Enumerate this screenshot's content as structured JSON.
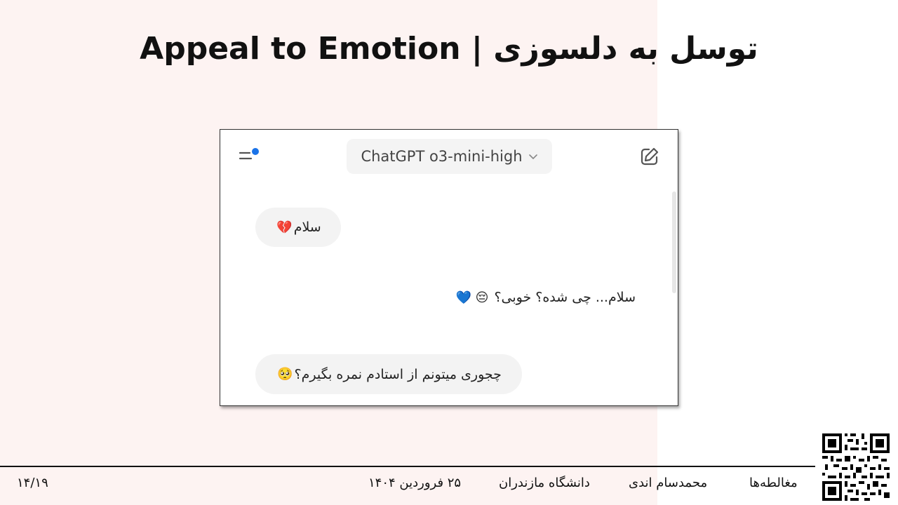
{
  "slide": {
    "title": "توسل به دلسوزی | Appeal to Emotion"
  },
  "chat": {
    "model_label": "ChatGPT o3-mini-high",
    "messages": [
      {
        "role": "user",
        "text": "سلام",
        "emoji": "💔"
      },
      {
        "role": "assistant",
        "text": "سلام... چی شده؟ خوبی؟",
        "emoji": "😔 💙"
      },
      {
        "role": "user",
        "text": "چجوری میتونم از استادم نمره بگیرم؟",
        "emoji": "🥺"
      }
    ],
    "icons": {
      "sidebar": "sidebar-menu-icon",
      "dropdown": "chevron-down-icon",
      "new_chat": "edit-icon"
    },
    "colors": {
      "notification_dot": "#1a73e8",
      "bubble_bg": "#f3f3f3"
    }
  },
  "footer": {
    "page_number": "۱۴/۱۹",
    "date": "۲۵ فروردین ۱۴۰۴",
    "university": "دانشگاه مازندران",
    "author": "محمدسام اندی",
    "topic": "مغالطه‌ها"
  }
}
